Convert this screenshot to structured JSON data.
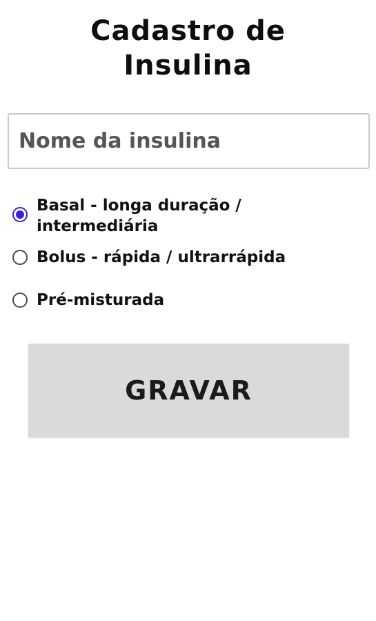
{
  "page": {
    "title_line1": "Cadastro de",
    "title_line2": "Insulina"
  },
  "form": {
    "name_input": {
      "placeholder": "Nome da insulina",
      "value": ""
    },
    "insulin_types": [
      {
        "label": "Basal - longa duração / intermediária",
        "checked": true
      },
      {
        "label": "Bolus - rápida / ultrarrápida",
        "checked": false
      },
      {
        "label": "Pré-misturada",
        "checked": false
      }
    ],
    "save_label": "GRAVAR"
  },
  "colors": {
    "accent": "#3b1fd6",
    "button_bg": "#d9dada",
    "input_border": "#c9c9c9"
  }
}
